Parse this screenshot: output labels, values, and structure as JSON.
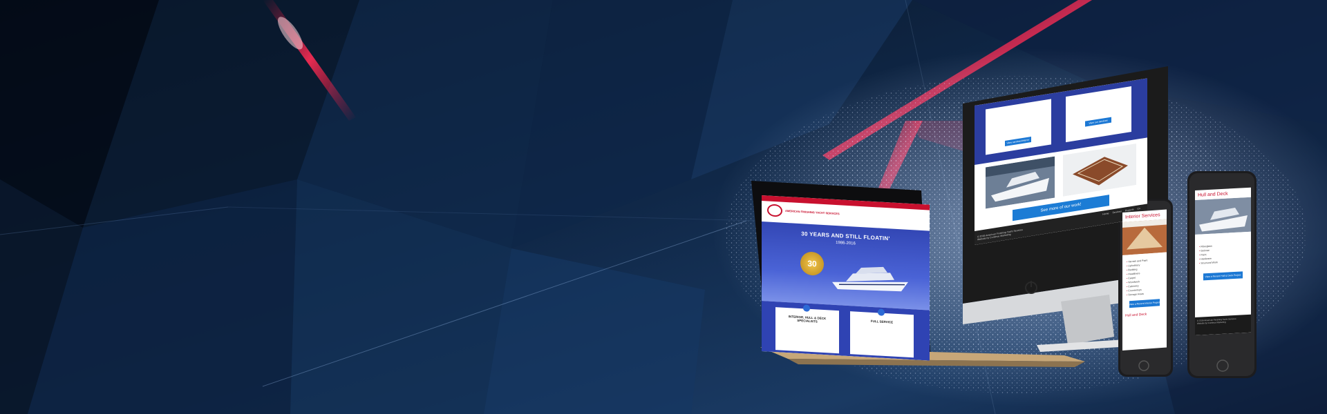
{
  "colors": {
    "background_dark": "#0a1424",
    "background_navy": "#142a4a",
    "accent_red": "#c8102e",
    "site_blue": "#2b3d9f",
    "button_blue": "#1c78d4"
  },
  "laptop": {
    "brand_line": "AMERICAN FINISHING YACHT SERVICES",
    "hero_title": "30 YEARS AND STILL FLOATIN'",
    "hero_years": "1986-2016",
    "badge": "30",
    "card_left_title": "INTERIOR, HULL & DECK SPECIALISTS",
    "card_right_title": "FULL SERVICE"
  },
  "imac": {
    "button_left": "View services/interior",
    "button_right": "View our services",
    "cta_label": "See more of our work!",
    "footer_nav": [
      "Home",
      "Services",
      "Projects",
      "Co"
    ],
    "footer_copyright": "© 2016 American Finishing Yacht Services",
    "footer_credit": "Website by Continue Marketing"
  },
  "phone1": {
    "title": "Interior Services",
    "list": [
      "Varnish and Paint",
      "Upholstery",
      "Bedding",
      "Headliners",
      "Carpet",
      "Woodwork",
      "Cabinetry",
      "Countertops",
      "Storage Areas"
    ],
    "button_label": "View a Recent Interior Project",
    "bottom_heading": "Hull and Deck"
  },
  "phone2": {
    "title": "Hull and Deck",
    "list": [
      "Fiberglass",
      "Gelcoat",
      "Paint",
      "Hardware",
      "Structural Work"
    ],
    "button_label": "View a Recent Hull & Deck Project",
    "footer_copyright": "© 2016 American Finishing Yacht Services",
    "footer_credit": "Website by Continue Marketing"
  }
}
